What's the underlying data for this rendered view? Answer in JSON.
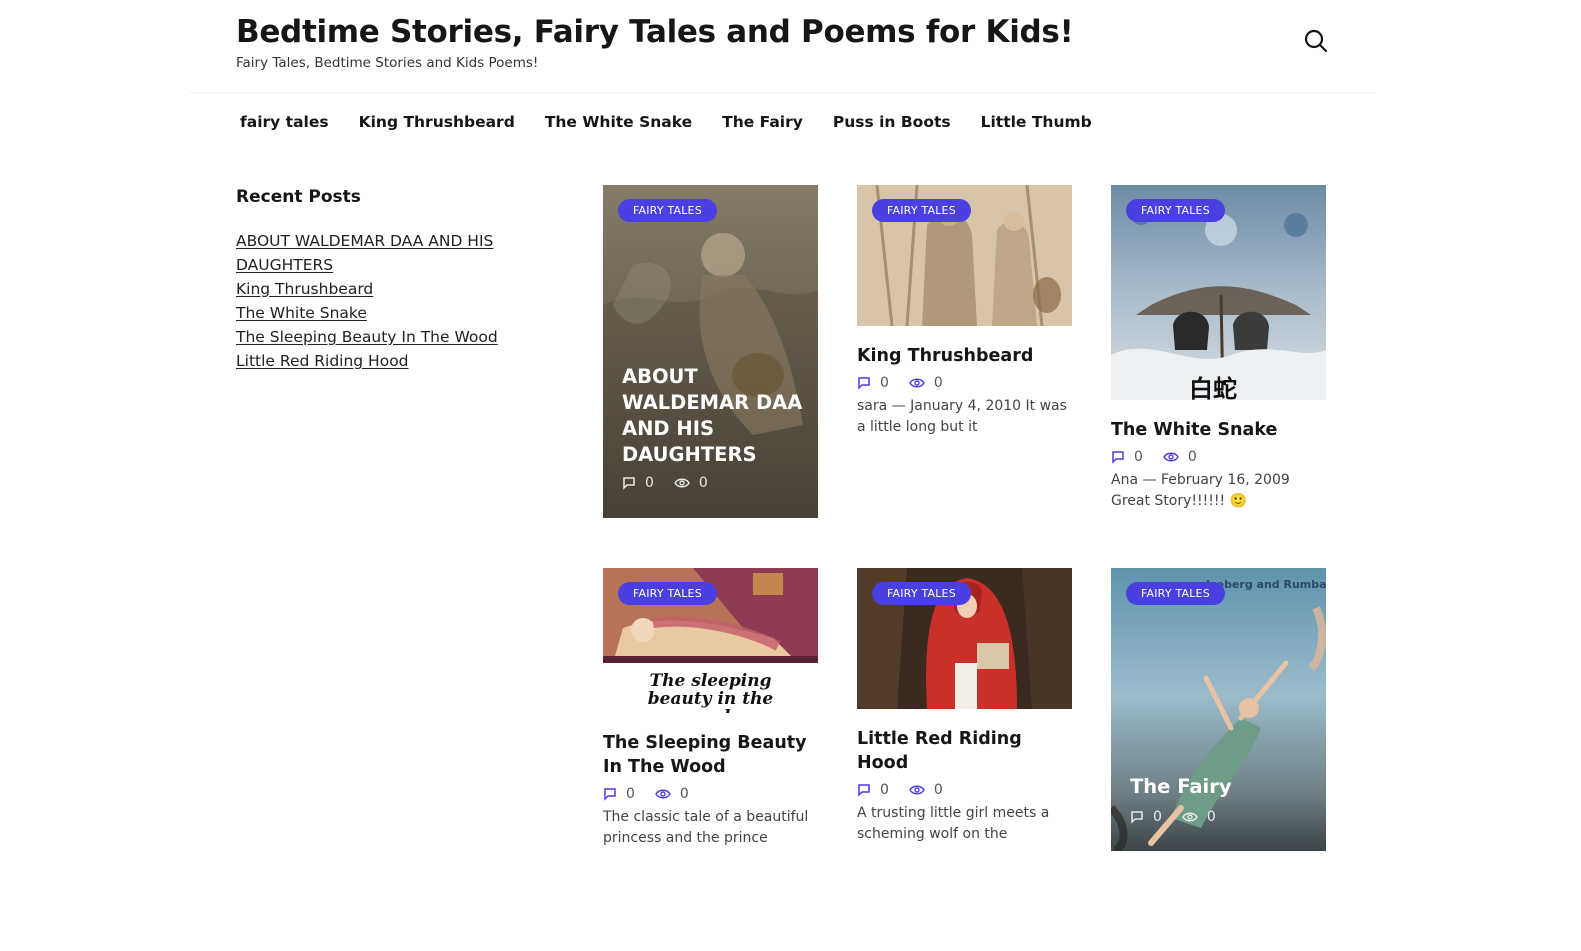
{
  "header": {
    "site_title": "Bedtime Stories, Fairy Tales and Poems for Kids!",
    "tagline": "Fairy Tales, Bedtime Stories and Kids Poems!",
    "search_icon": "search-icon"
  },
  "nav": {
    "items": [
      {
        "label": "fairy tales"
      },
      {
        "label": "King Thrushbeard"
      },
      {
        "label": "The White Snake"
      },
      {
        "label": "The Fairy"
      },
      {
        "label": "Puss in Boots"
      },
      {
        "label": "Little Thumb"
      }
    ]
  },
  "sidebar": {
    "title": "Recent Posts",
    "posts": [
      {
        "label": "ABOUT WALDEMAR DAA AND HIS DAUGHTERS"
      },
      {
        "label": "King Thrushbeard"
      },
      {
        "label": "The White Snake"
      },
      {
        "label": "The Sleeping Beauty In The Wood"
      },
      {
        "label": "Little Red Riding Hood"
      }
    ]
  },
  "colors": {
    "accent": "#4a3fe0",
    "text": "#161616"
  },
  "posts": [
    {
      "category": "FAIRY TALES",
      "title": "ABOUT WALDEMAR DAA AND HIS DAUGHTERS",
      "comments": "0",
      "views": "0"
    },
    {
      "category": "FAIRY TALES",
      "title": "King Thrushbeard",
      "comments": "0",
      "views": "0",
      "excerpt": "sara — January 4, 2010 It was a little long but it"
    },
    {
      "category": "FAIRY TALES",
      "title": "The White Snake",
      "comments": "0",
      "views": "0",
      "excerpt": "Ana — February 16, 2009 Great Story!!!!!! 🙂",
      "image_text": "白蛇"
    },
    {
      "category": "FAIRY TALES",
      "title": "The Sleeping Beauty In The Wood",
      "comments": "0",
      "views": "0",
      "excerpt": "The classic tale of a beautiful princess and the prince",
      "image_caption": "The sleeping beauty in the woods"
    },
    {
      "category": "FAIRY TALES",
      "title": "Little Red Riding Hood",
      "comments": "0",
      "views": "0",
      "excerpt": "A trusting little girl meets a scheming wolf on the"
    },
    {
      "category": "FAIRY TALES",
      "title": "The Fairy",
      "comments": "0",
      "views": "0",
      "image_text": "Iceberg and Rumba"
    }
  ]
}
